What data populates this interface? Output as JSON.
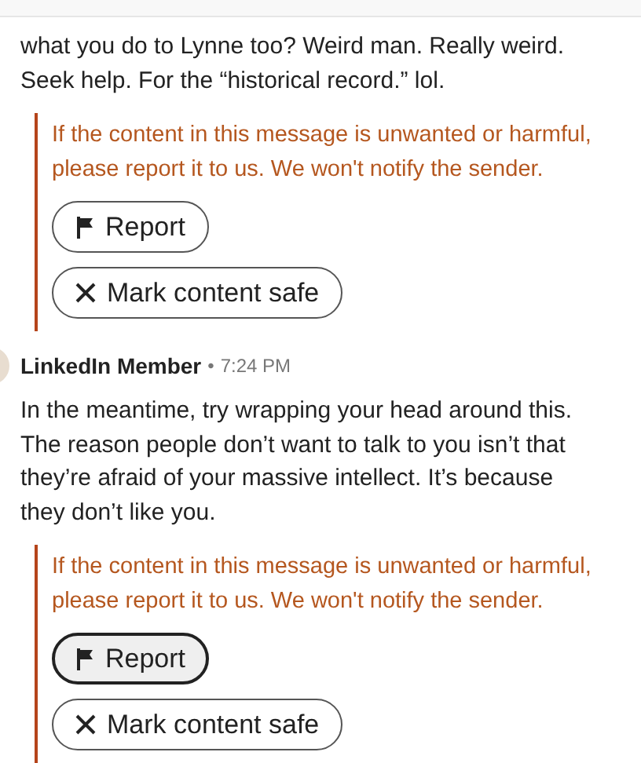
{
  "messages": [
    {
      "body": "what you do to Lynne too? Weird man. Really weird.\nSeek help. For the “historical record.” lol.",
      "warning": {
        "text": "If the content in this message is unwanted or harmful, please report it to us. We won't notify the sender.",
        "buttons": [
          {
            "kind": "report",
            "label": "Report",
            "hovered": false
          },
          {
            "kind": "safe",
            "label": "Mark content safe",
            "hovered": false
          }
        ]
      }
    },
    {
      "sender": "LinkedIn Member",
      "separator": "•",
      "time": "7:24 PM",
      "body": "In the meantime, try wrapping your head around this.\nThe reason people don’t want to talk to you isn’t that\nthey’re afraid of your massive intellect. It’s because\nthey don’t like you.",
      "warning": {
        "text": "If the content in this message is unwanted or harmful, please report it to us. We won't notify the sender.",
        "buttons": [
          {
            "kind": "report",
            "label": "Report",
            "hovered": true
          },
          {
            "kind": "safe",
            "label": "Mark content safe",
            "hovered": false
          }
        ]
      }
    }
  ]
}
